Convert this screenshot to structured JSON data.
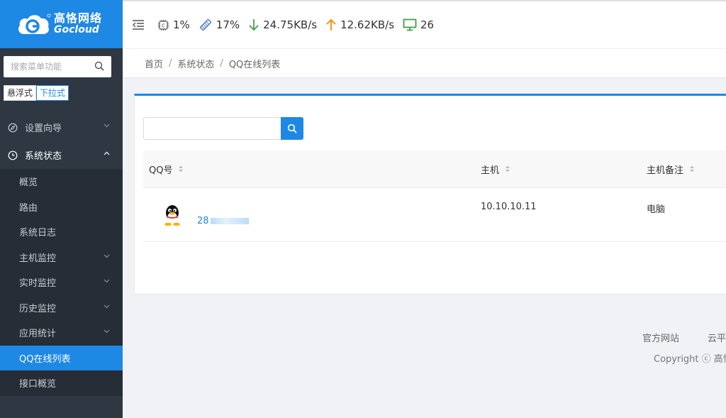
{
  "brand": {
    "name_cn": "高恪网络",
    "name_en": "Gocloud"
  },
  "sidebar": {
    "search_placeholder": "搜索菜单功能",
    "mode_float": "悬浮式",
    "mode_dropdown": "下拉式",
    "menu": [
      {
        "label": "设置向导",
        "icon": "compass-icon",
        "expanded": false
      },
      {
        "label": "系统状态",
        "icon": "clock-icon",
        "expanded": true
      }
    ],
    "submenu": [
      {
        "label": "概览"
      },
      {
        "label": "路由"
      },
      {
        "label": "系统日志"
      },
      {
        "label": "主机监控",
        "has_children": true
      },
      {
        "label": "实时监控",
        "has_children": true
      },
      {
        "label": "历史监控",
        "has_children": true
      },
      {
        "label": "应用统计",
        "has_children": true
      },
      {
        "label": "QQ在线列表",
        "active": true
      },
      {
        "label": "接口概览"
      }
    ]
  },
  "header": {
    "cpu": "1%",
    "memory": "17%",
    "download": "24.75KB/s",
    "upload": "12.62KB/s",
    "hosts": "26"
  },
  "breadcrumb": [
    "首页",
    "系统状态",
    "QQ在线列表"
  ],
  "table": {
    "columns": [
      "QQ号",
      "主机",
      "主机备注"
    ],
    "rows": [
      {
        "qq": "28",
        "host": "10.10.10.11",
        "note": "电脑"
      }
    ]
  },
  "footer": {
    "links": [
      "官方网站",
      "云平"
    ],
    "copyright": "Copyright ⓒ 高恪"
  },
  "colors": {
    "accent": "#1e88e5",
    "sidebar_bg": "#2e3742",
    "download": "#43a047",
    "upload": "#fb8c00"
  }
}
